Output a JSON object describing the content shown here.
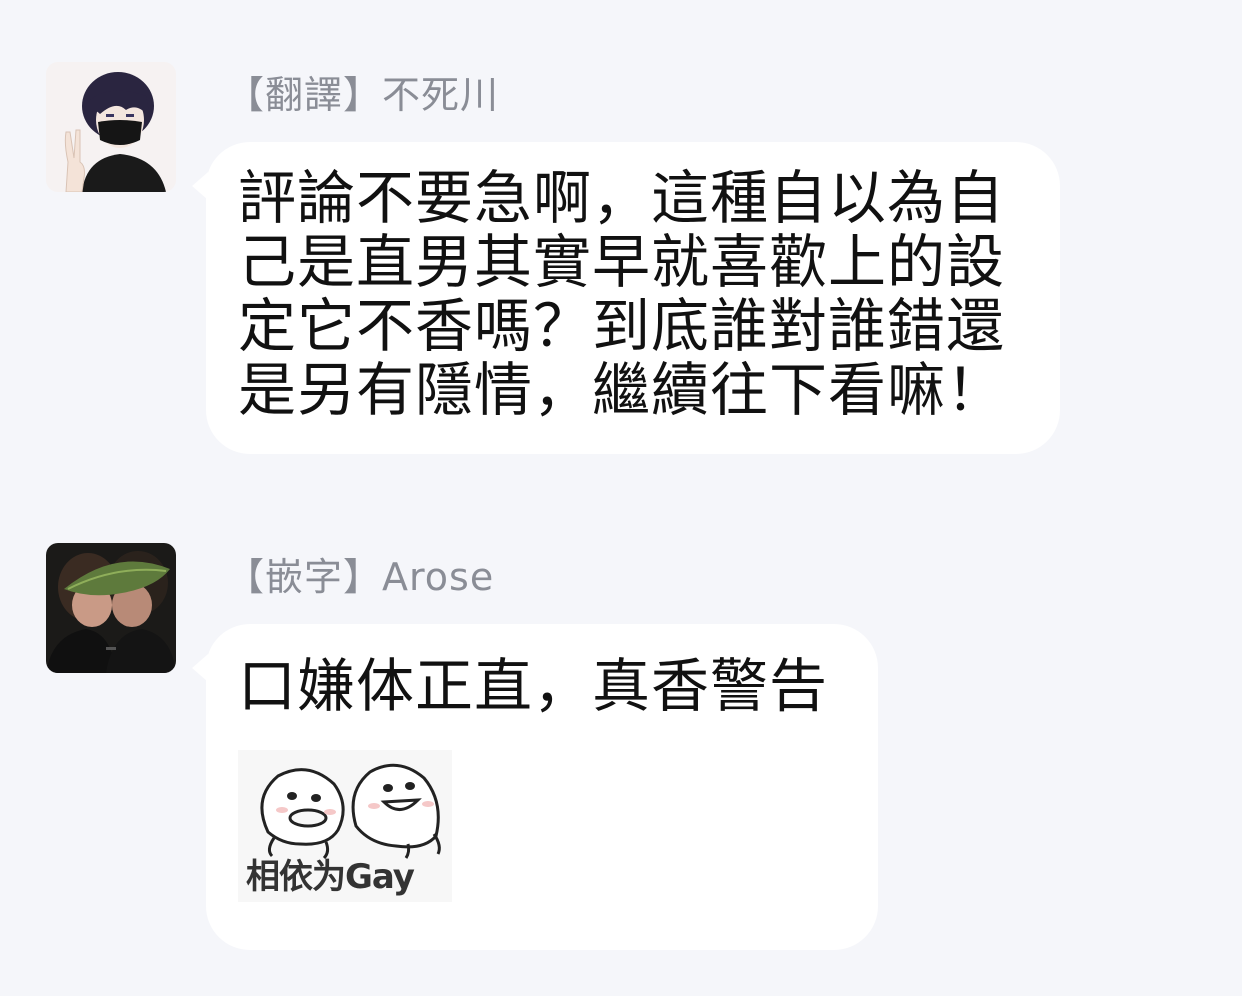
{
  "messages": [
    {
      "sender": "【翻譯】不死川",
      "avatar_icon": "avatar-masked-boy-icon",
      "text": "評論不要急啊，這種自以為自己是直男其實早就喜歡上的設定它不香嗎？到底誰對誰錯還是另有隱情，繼續往下看嘛！"
    },
    {
      "sender": "【嵌字】Arose",
      "avatar_icon": "avatar-leaf-kiss-icon",
      "text": "口嫌体正直，真香警告",
      "sticker": {
        "icon": "two-blobs-sticker-icon",
        "caption": "相依为Gay"
      }
    }
  ],
  "colors": {
    "background": "#f5f6fa",
    "bubble": "#ffffff",
    "sender": "#8a8d96",
    "text": "#111111"
  }
}
